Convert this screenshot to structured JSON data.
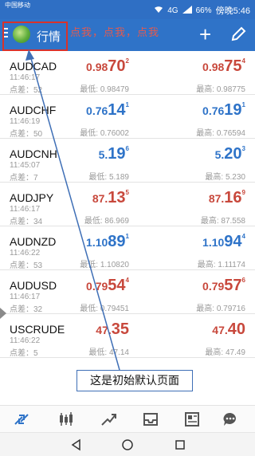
{
  "status_bar": {
    "carrier": "中国移动",
    "network": "4G",
    "battery": "66%",
    "clock": "傍晚5:46"
  },
  "app_bar": {
    "title": "行情",
    "overlay_text": "点我，点我，点我"
  },
  "quotes": [
    {
      "symbol": "AUDCAD",
      "time": "11:46:17",
      "spread_label": "点差：",
      "spread": "52",
      "color": "red",
      "bid": {
        "lead": "0.98",
        "big": "70",
        "sup": "2"
      },
      "ask": {
        "lead": "0.98",
        "big": "75",
        "sup": "4"
      },
      "low_label": "最低:",
      "low": "0.98479",
      "high_label": "最高:",
      "high": "0.98775"
    },
    {
      "symbol": "AUDCHF",
      "time": "11:46:19",
      "spread_label": "点差：",
      "spread": "50",
      "color": "blue",
      "bid": {
        "lead": "0.76",
        "big": "14",
        "sup": "1"
      },
      "ask": {
        "lead": "0.76",
        "big": "19",
        "sup": "1"
      },
      "low_label": "最低:",
      "low": "0.76002",
      "high_label": "最高:",
      "high": "0.76594"
    },
    {
      "symbol": "AUDCNH",
      "time": "11:45:07",
      "spread_label": "点差：",
      "spread": "7",
      "color": "blue",
      "bid": {
        "lead": "5.",
        "big": "19",
        "sup": "6"
      },
      "ask": {
        "lead": "5.",
        "big": "20",
        "sup": "3"
      },
      "low_label": "最低:",
      "low": "5.189",
      "high_label": "最高:",
      "high": "5.230"
    },
    {
      "symbol": "AUDJPY",
      "time": "11:46:17",
      "spread_label": "点差：",
      "spread": "34",
      "color": "red",
      "bid": {
        "lead": "87.",
        "big": "13",
        "sup": "5"
      },
      "ask": {
        "lead": "87.",
        "big": "16",
        "sup": "9"
      },
      "low_label": "最低:",
      "low": "86.969",
      "high_label": "最高:",
      "high": "87.558"
    },
    {
      "symbol": "AUDNZD",
      "time": "11:46:22",
      "spread_label": "点差：",
      "spread": "53",
      "color": "blue",
      "bid": {
        "lead": "1.10",
        "big": "89",
        "sup": "1"
      },
      "ask": {
        "lead": "1.10",
        "big": "94",
        "sup": "4"
      },
      "low_label": "最低:",
      "low": "1.10820",
      "high_label": "最高:",
      "high": "1.11174"
    },
    {
      "symbol": "AUDUSD",
      "time": "11:46:17",
      "spread_label": "点差：",
      "spread": "32",
      "color": "red",
      "bid": {
        "lead": "0.79",
        "big": "54",
        "sup": "4"
      },
      "ask": {
        "lead": "0.79",
        "big": "57",
        "sup": "6"
      },
      "low_label": "最低:",
      "low": "0.79451",
      "high_label": "最高:",
      "high": "0.79716"
    },
    {
      "symbol": "USCRUDE",
      "time": "11:46:22",
      "spread_label": "点差：",
      "spread": "5",
      "color": "red",
      "bid": {
        "lead": "47.",
        "big": "35",
        "sup": ""
      },
      "ask": {
        "lead": "47.",
        "big": "40",
        "sup": ""
      },
      "low_label": "最低:",
      "low": "47.14",
      "high_label": "最高:",
      "high": "47.49"
    }
  ],
  "annotation": {
    "text": "这是初始默认页面"
  },
  "bottom_nav": [
    "quotes-icon",
    "chart-candles-icon",
    "trade-trend-icon",
    "inbox-icon",
    "news-icon",
    "chat-icon"
  ],
  "system_nav": [
    "back-icon",
    "home-icon",
    "recents-icon"
  ],
  "colors": {
    "app_bar": "#2f73c8",
    "price_red": "#c8483c",
    "price_blue": "#2e73c8",
    "annotation_red": "#d9322a"
  }
}
